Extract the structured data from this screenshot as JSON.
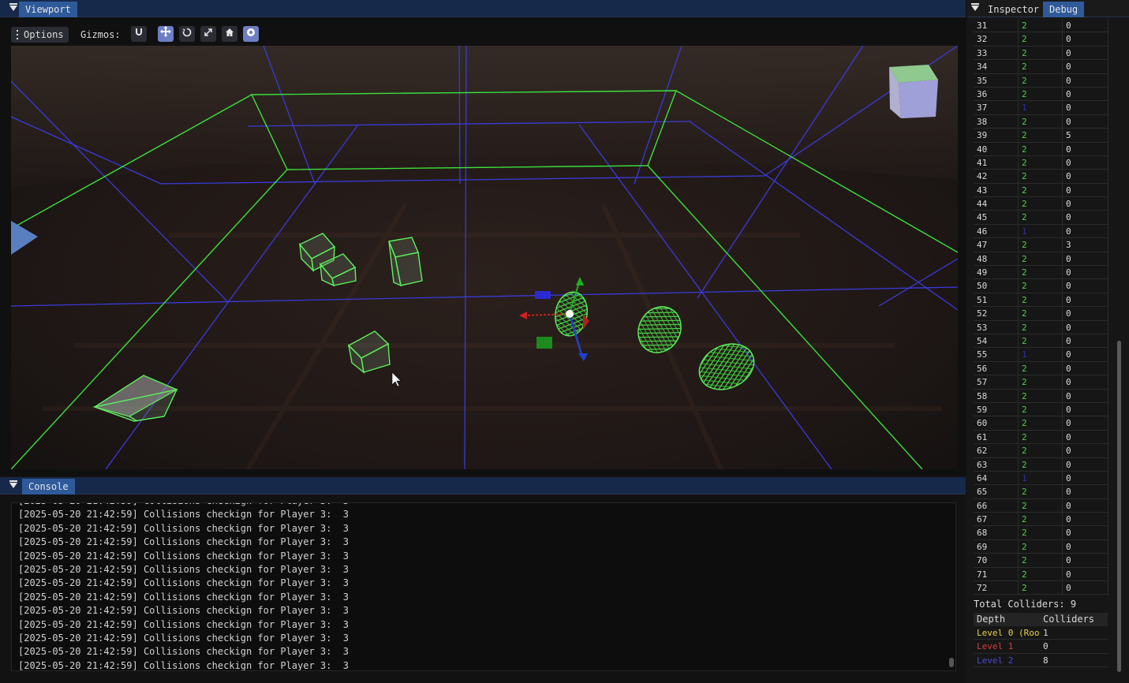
{
  "viewport": {
    "tab": "Viewport",
    "options_label": "Options",
    "gizmos_label": "Gizmos:",
    "tool_icons": [
      "magnet-icon",
      "move-icon",
      "rotate-icon",
      "scale-icon",
      "home-icon",
      "globe-icon"
    ],
    "active_tools": [
      "move-icon",
      "globe-icon"
    ]
  },
  "console": {
    "tab": "Console",
    "lines": [
      "[2025-05-20 21:42:59] Collisions checkign for Player 3:  3",
      "[2025-05-20 21:42:59] Collisions checkign for Player 3:  3",
      "[2025-05-20 21:42:59] Collisions checkign for Player 3:  3",
      "[2025-05-20 21:42:59] Collisions checkign for Player 3:  3",
      "[2025-05-20 21:42:59] Collisions checkign for Player 3:  3",
      "[2025-05-20 21:42:59] Collisions checkign for Player 3:  3",
      "[2025-05-20 21:42:59] Collisions checkign for Player 3:  3",
      "[2025-05-20 21:42:59] Collisions checkign for Player 3:  3",
      "[2025-05-20 21:42:59] Collisions checkign for Player 3:  3",
      "[2025-05-20 21:42:59] Collisions checkign for Player 3:  3",
      "[2025-05-20 21:42:59] Collisions checkign for Player 3:  3",
      "[2025-05-20 21:42:59] Collisions checkign for Player 3:  3",
      "[2025-05-20 21:42:59] Collisions checkign for Player 3:  3"
    ]
  },
  "inspector": {
    "tab": "Inspector",
    "debug_tab": "Debug",
    "rows": [
      [
        "31",
        "2",
        "0"
      ],
      [
        "32",
        "2",
        "0"
      ],
      [
        "33",
        "2",
        "0"
      ],
      [
        "34",
        "2",
        "0"
      ],
      [
        "35",
        "2",
        "0"
      ],
      [
        "36",
        "2",
        "0"
      ],
      [
        "37",
        "1",
        "0"
      ],
      [
        "38",
        "2",
        "0"
      ],
      [
        "39",
        "2",
        "5"
      ],
      [
        "40",
        "2",
        "0"
      ],
      [
        "41",
        "2",
        "0"
      ],
      [
        "42",
        "2",
        "0"
      ],
      [
        "43",
        "2",
        "0"
      ],
      [
        "44",
        "2",
        "0"
      ],
      [
        "45",
        "2",
        "0"
      ],
      [
        "46",
        "1",
        "0"
      ],
      [
        "47",
        "2",
        "3"
      ],
      [
        "48",
        "2",
        "0"
      ],
      [
        "49",
        "2",
        "0"
      ],
      [
        "50",
        "2",
        "0"
      ],
      [
        "51",
        "2",
        "0"
      ],
      [
        "52",
        "2",
        "0"
      ],
      [
        "53",
        "2",
        "0"
      ],
      [
        "54",
        "2",
        "0"
      ],
      [
        "55",
        "1",
        "0"
      ],
      [
        "56",
        "2",
        "0"
      ],
      [
        "57",
        "2",
        "0"
      ],
      [
        "58",
        "2",
        "0"
      ],
      [
        "59",
        "2",
        "0"
      ],
      [
        "60",
        "2",
        "0"
      ],
      [
        "61",
        "2",
        "0"
      ],
      [
        "62",
        "2",
        "0"
      ],
      [
        "63",
        "2",
        "0"
      ],
      [
        "64",
        "1",
        "0"
      ],
      [
        "65",
        "2",
        "0"
      ],
      [
        "66",
        "2",
        "0"
      ],
      [
        "67",
        "2",
        "0"
      ],
      [
        "68",
        "2",
        "0"
      ],
      [
        "69",
        "2",
        "0"
      ],
      [
        "70",
        "2",
        "0"
      ],
      [
        "71",
        "2",
        "0"
      ],
      [
        "72",
        "2",
        "0"
      ]
    ],
    "total_colliders": "Total Colliders: 9",
    "depth_header": [
      "Depth",
      "Colliders"
    ],
    "levels": [
      {
        "name": "Level 0 (Roo",
        "value": "1",
        "color": "#e8d24a"
      },
      {
        "name": "Level 1",
        "value": "0",
        "color": "#d83c3c"
      },
      {
        "name": "Level 2",
        "value": "8",
        "color": "#4a4ad8"
      }
    ],
    "depth2_color": "#4fcf4f",
    "depth1_color": "#3030a8"
  }
}
